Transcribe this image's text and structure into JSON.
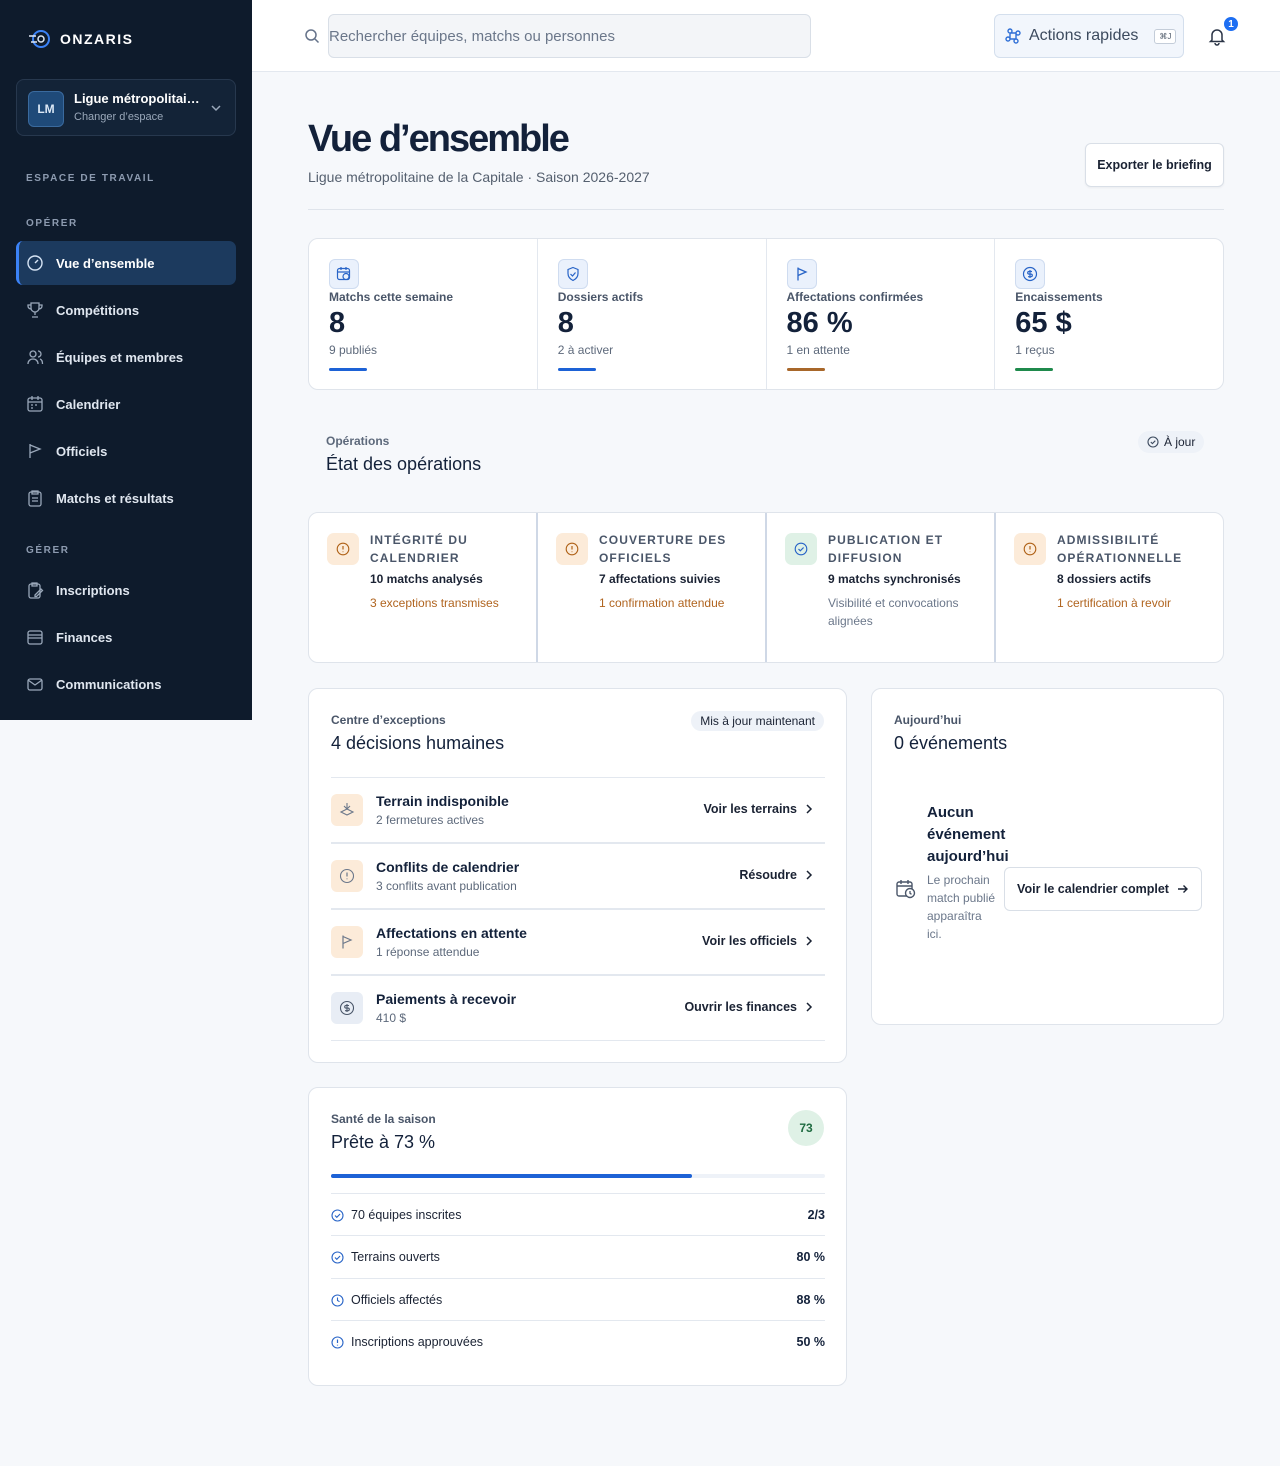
{
  "brand": {
    "name": "ONZARIS"
  },
  "workspace": {
    "initials": "LM",
    "name": "Ligue métropolitaine de la Capitale",
    "switch_label": "Changer d’espace"
  },
  "sidebar": {
    "section_workspace": "ESPACE DE TRAVAIL",
    "section_operate": "OPÉRER",
    "section_manage": "GÉRER",
    "operate_items": [
      {
        "label": "Vue d’ensemble",
        "icon": "gauge-icon",
        "active": true
      },
      {
        "label": "Compétitions",
        "icon": "trophy-icon"
      },
      {
        "label": "Équipes et membres",
        "icon": "users-icon"
      },
      {
        "label": "Calendrier",
        "icon": "calendar-icon"
      },
      {
        "label": "Officiels",
        "icon": "flag-icon"
      },
      {
        "label": "Matchs et résultats",
        "icon": "clipboard-icon"
      }
    ],
    "manage_items": [
      {
        "label": "Inscriptions",
        "icon": "clipboard-edit-icon"
      },
      {
        "label": "Finances",
        "icon": "wallet-icon"
      },
      {
        "label": "Communications",
        "icon": "mail-icon"
      }
    ]
  },
  "topbar": {
    "search_placeholder": "Rechercher équipes, matchs ou personnes",
    "quick_actions": "Actions rapides",
    "quick_actions_kbd": "⌘J",
    "notifications_count": "1"
  },
  "header": {
    "title": "Vue d’ensemble",
    "subtitle": "Ligue métropolitaine de la Capitale · Saison 2026-2027",
    "export_label": "Exporter le briefing"
  },
  "kpis": [
    {
      "label": "Matchs cette semaine",
      "value": "8",
      "sub": "9 publiés",
      "icon": "calendar-clock-icon",
      "accent": "#1d62d6"
    },
    {
      "label": "Dossiers actifs",
      "value": "8",
      "sub": "2 à activer",
      "icon": "shield-check-icon",
      "accent": "#1d62d6"
    },
    {
      "label": "Affectations confirmées",
      "value": "86 %",
      "sub": "1 en attente",
      "icon": "flag-icon",
      "accent": "#a8672a"
    },
    {
      "label": "Encaissements",
      "value": "65 $",
      "sub": "1 reçus",
      "icon": "dollar-circle-icon",
      "accent": "#1f8a4c"
    }
  ],
  "operations": {
    "label": "Opérations",
    "title": "État des opérations",
    "status": "À jour",
    "cards": [
      {
        "title": "Intégrité du calendrier",
        "main": "10 matchs analysés",
        "note": "3 exceptions transmises",
        "status": "warning"
      },
      {
        "title": "Couverture des officiels",
        "main": "7 affectations suivies",
        "note": "1 confirmation attendue",
        "status": "warning"
      },
      {
        "title": "Publication et diffusion",
        "main": "9 matchs synchronisés",
        "note": "Visibilité et convocations alignées",
        "status": "ok"
      },
      {
        "title": "Admissibilité opérationnelle",
        "main": "8 dossiers actifs",
        "note": "1 certification à revoir",
        "status": "warning"
      }
    ]
  },
  "exceptions": {
    "label": "Centre d’exceptions",
    "title": "4 décisions humaines",
    "updated": "Mis à jour maintenant",
    "items": [
      {
        "title": "Terrain indisponible",
        "sub": "2 fermetures actives",
        "action": "Voir les terrains",
        "icon": "field-icon"
      },
      {
        "title": "Conflits de calendrier",
        "sub": "3 conflits avant publication",
        "action": "Résoudre",
        "icon": "alert-circle-icon"
      },
      {
        "title": "Affectations en attente",
        "sub": "1 réponse attendue",
        "action": "Voir les officiels",
        "icon": "flag-icon"
      },
      {
        "title": "Paiements à recevoir",
        "sub": "410 $",
        "action": "Ouvrir les finances",
        "icon": "dollar-circle-icon"
      }
    ]
  },
  "today": {
    "label": "Aujourd’hui",
    "title": "0 événements",
    "empty_title": "Aucun événement aujourd’hui",
    "empty_text": "Le prochain match publié apparaîtra ici.",
    "button": "Voir le calendrier complet"
  },
  "health": {
    "label": "Santé de la saison",
    "title": "Prête à 73 %",
    "score": "73",
    "progress": 0.73,
    "rows": [
      {
        "label": "70 équipes inscrites",
        "value": "2/3",
        "icon": "check-circle-icon"
      },
      {
        "label": "Terrains ouverts",
        "value": "80 %",
        "icon": "check-circle-icon"
      },
      {
        "label": "Officiels affectés",
        "value": "88 %",
        "icon": "clock-icon"
      },
      {
        "label": "Inscriptions approuvées",
        "value": "50 %",
        "icon": "alert-circle-icon"
      }
    ]
  }
}
